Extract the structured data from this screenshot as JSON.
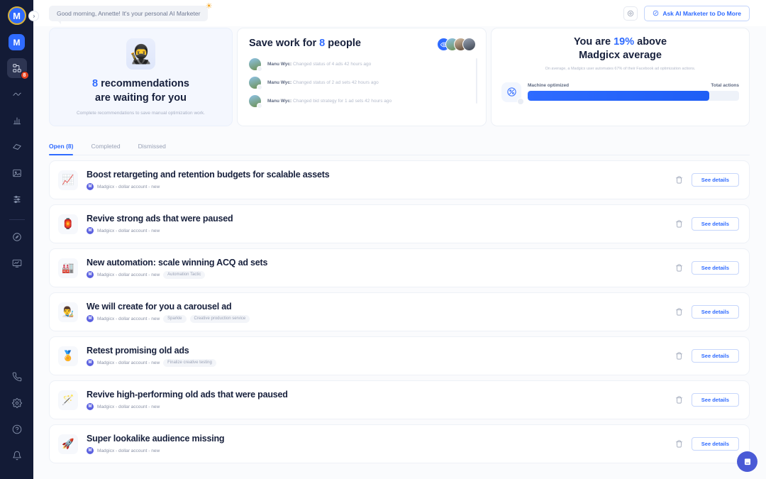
{
  "sidebar": {
    "logo_label": "M",
    "logo_second_label": "M",
    "items": [
      {
        "name": "recommendations",
        "icon": "sitemap-icon",
        "badge": "8",
        "active": true
      },
      {
        "name": "audiences",
        "icon": "wave-icon",
        "badge": "",
        "active": false
      },
      {
        "name": "analytics",
        "icon": "bar-chart-icon",
        "badge": "",
        "active": false
      },
      {
        "name": "tactics",
        "icon": "diamond-icon",
        "badge": "",
        "active": false
      },
      {
        "name": "creative",
        "icon": "image-icon",
        "badge": "",
        "active": false
      },
      {
        "name": "settings-sliders",
        "icon": "sliders-icon",
        "badge": "",
        "active": false
      },
      {
        "name": "explore",
        "icon": "compass-icon",
        "badge": "",
        "active": false
      },
      {
        "name": "reports",
        "icon": "monitor-chart-icon",
        "badge": "",
        "active": false
      }
    ],
    "bottom_items": [
      {
        "name": "call",
        "icon": "phone-icon"
      },
      {
        "name": "settings",
        "icon": "gear-icon"
      },
      {
        "name": "help",
        "icon": "question-icon"
      },
      {
        "name": "notifications",
        "icon": "bell-icon"
      }
    ]
  },
  "topbar": {
    "greeting": "Good morning, Annette! It's your personal AI Marketer",
    "sparkle_icon": "sun-sparkle-icon",
    "settings_icon": "gear-icon",
    "ask_button_label": "Ask AI Marketer to Do More",
    "ask_button_icon": "sparkle-icon"
  },
  "recommendations_card": {
    "avatar_emoji": "🥷",
    "count": "8",
    "title_rest": " recommendations",
    "title_line2": "are waiting for you",
    "subtitle": "Complete recommendations to save manual optimization work."
  },
  "activity_card": {
    "title_prefix": "Save work for ",
    "count": "8",
    "title_suffix": " people",
    "eye_icon": "eye-icon",
    "feed": [
      {
        "user": "Manu Wyc",
        "action": " Changed status of 4 ads 42 hours ago"
      },
      {
        "user": "Manu Wyc",
        "action": " Changed status of 2 ad sets 42 hours ago"
      },
      {
        "user": "Manu Wyc",
        "action": " Changed bid strategy for 1 ad sets 42 hours ago"
      }
    ]
  },
  "benchmark_card": {
    "title_prefix": "You are ",
    "percent": "19%",
    "title_suffix": " above",
    "title_line2": "Madgicx average",
    "subtitle": "On average, a Madgicx user automates 67% of their Facebook ad optimization actions.",
    "meter_icon": "cookie-icon",
    "left_label": "Machine optimized",
    "right_label": "Total actions",
    "fill_percent": 86
  },
  "tabs": [
    {
      "label": "Open (8)",
      "active": true
    },
    {
      "label": "Completed",
      "active": false
    },
    {
      "label": "Dismissed",
      "active": false
    }
  ],
  "recommendations": [
    {
      "icon": "📈",
      "title": "Boost retargeting and retention budgets for scalable assets",
      "account": "Madgicx - dollar account - new",
      "account_initial": "M",
      "tags": [],
      "delete_icon": "trash-icon",
      "details_label": "See details"
    },
    {
      "icon": "🏮",
      "title": "Revive strong ads that were paused",
      "account": "Madgicx - dollar account - new",
      "account_initial": "M",
      "tags": [],
      "delete_icon": "trash-icon",
      "details_label": "See details"
    },
    {
      "icon": "🏭",
      "title": "New automation: scale winning ACQ ad sets",
      "account": "Madgicx - dollar account - new",
      "account_initial": "M",
      "tags": [
        "Automation Tactic"
      ],
      "delete_icon": "trash-icon",
      "details_label": "See details"
    },
    {
      "icon": "👨‍🎨",
      "title": "We will create for you a carousel ad",
      "account": "Madgicx - dollar account - new",
      "account_initial": "M",
      "tags": [
        "Sparkle",
        "Creative production service"
      ],
      "delete_icon": "trash-icon",
      "details_label": "See details"
    },
    {
      "icon": "🏅",
      "title": "Retest promising old ads",
      "account": "Madgicx - dollar account - new",
      "account_initial": "M",
      "tags": [
        "Finalize creative testing"
      ],
      "delete_icon": "trash-icon",
      "details_label": "See details"
    },
    {
      "icon": "🪄",
      "title": "Revive high-performing old ads that were paused",
      "account": "Madgicx - dollar account - new",
      "account_initial": "M",
      "tags": [],
      "delete_icon": "trash-icon",
      "details_label": "See details"
    },
    {
      "icon": "🚀",
      "title": "Super lookalike audience missing",
      "account": "Madgicx - dollar account - new",
      "account_initial": "M",
      "tags": [],
      "delete_icon": "trash-icon",
      "details_label": "See details"
    }
  ],
  "chat_widget": {
    "icon": "chat-icon"
  },
  "colors": {
    "accent": "#2f6bff",
    "sidebar_bg": "#131b36",
    "badge_red": "#e8431f"
  }
}
